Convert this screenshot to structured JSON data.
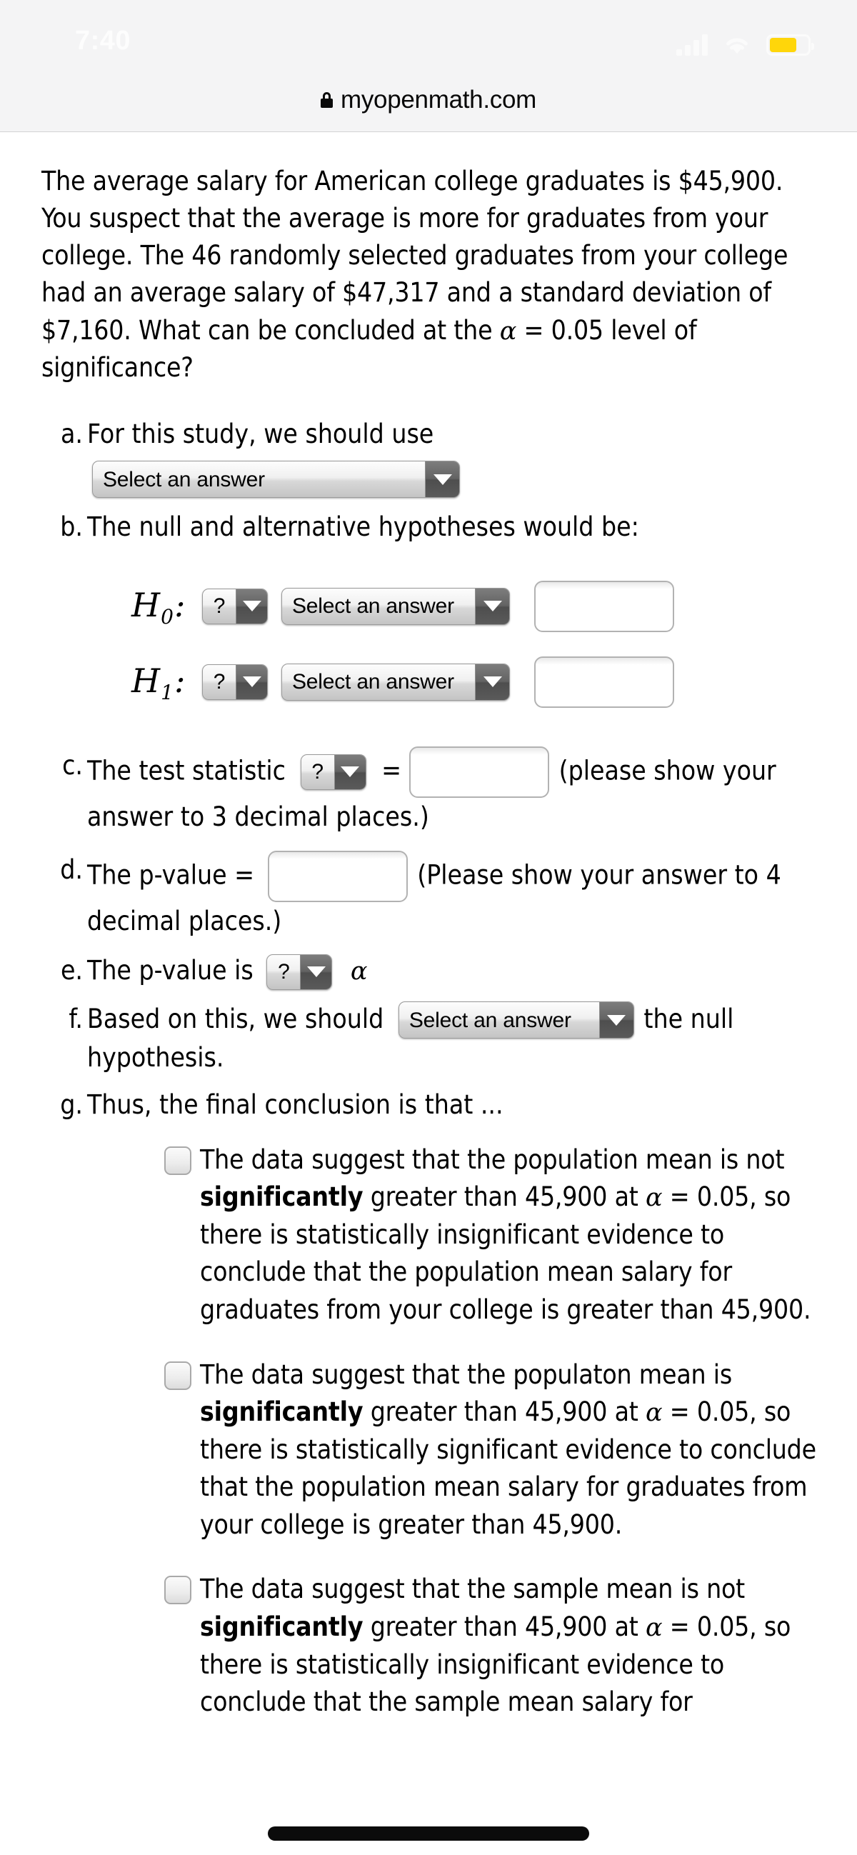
{
  "status_bar": {
    "time": "7:40",
    "signal_icon": "cellular-signal-icon",
    "wifi_icon": "wifi-icon",
    "battery_icon": "battery-icon",
    "battery_color": "#ffd60a"
  },
  "url_bar": {
    "lock_icon": "lock-icon",
    "url": "myopenmath.com"
  },
  "problem": {
    "text": "The average salary for American college graduates is $45,900. You suspect that the average is more for graduates from your college. The 46 randomly selected graduates from your college had an average salary of $47,317 and a standard deviation of $7,160. What can be concluded at the ",
    "alpha": "α",
    "text_tail": " = 0.05 level of significance?"
  },
  "parts": {
    "a": {
      "marker": "a.",
      "text": "For this study, we should use",
      "select_value": "Select an answer"
    },
    "b": {
      "marker": "b.",
      "text": "The null and alternative hypotheses would be:",
      "h0_label": "H",
      "h0_sub": "0",
      "h1_label": "H",
      "h1_sub": "1",
      "colon": ":",
      "qmark": "?",
      "select_value": "Select an answer",
      "input_value": ""
    },
    "c": {
      "marker": "c.",
      "text_before": "The test statistic",
      "qmark": "?",
      "equals": "=",
      "input_value": "",
      "text_after": "(please show your answer to 3 decimal places.)"
    },
    "d": {
      "marker": "d.",
      "text_before": "The p-value =",
      "input_value": "",
      "text_after": "(Please show your answer to 4 decimal places.)"
    },
    "e": {
      "marker": "e.",
      "text_before": "The p-value is",
      "qmark": "?",
      "alpha": "α"
    },
    "f": {
      "marker": "f.",
      "text_before": "Based on this, we should",
      "select_value": "Select an answer",
      "text_after": "the null hypothesis."
    },
    "g": {
      "marker": "g.",
      "text": "Thus, the final conclusion is that ...",
      "choices": [
        {
          "seg1": "The data suggest that the population mean is not ",
          "bold": "significantly",
          "seg2": " greater than 45,900 at ",
          "alpha": "α",
          "seg3": " = 0.05, so there is statistically insignificant evidence to conclude that the population mean salary for graduates from your college is greater than 45,900."
        },
        {
          "seg1": "The data suggest that the populaton mean is ",
          "bold": "significantly",
          "seg2": " greater than 45,900 at ",
          "alpha": "α",
          "seg3": " = 0.05, so there is statistically significant evidence to conclude that the population mean salary for graduates from your college is greater than 45,900."
        },
        {
          "seg1": "The data suggest that the sample mean is not ",
          "bold": "significantly",
          "seg2": " greater than 45,900 at ",
          "alpha": "α",
          "seg3": " = 0.05, so there is statistically insignificant evidence to conclude that the sample mean salary for"
        }
      ]
    }
  }
}
